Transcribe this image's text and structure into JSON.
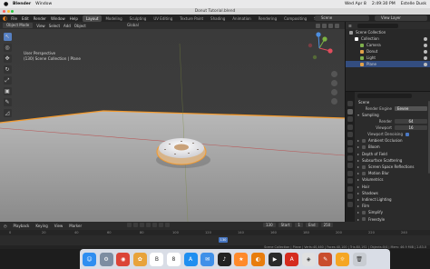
{
  "macos": {
    "apple": "",
    "app": "Blender",
    "menus": [
      "Window"
    ],
    "status_right": [
      "Wed Apr 8",
      "2:49:30 PM",
      "Estelle Dusk"
    ]
  },
  "window": {
    "title": "Donut Tutorial.blend"
  },
  "topbar": {
    "menus": [
      "File",
      "Edit",
      "Render",
      "Window",
      "Help"
    ],
    "tabs": [
      "Layout",
      "Modeling",
      "Sculpting",
      "UV Editing",
      "Texture Paint",
      "Shading",
      "Animation",
      "Rendering",
      "Compositing",
      "Scripting"
    ],
    "active_tab": "Layout",
    "scene": "Scene",
    "view_layer": "View Layer"
  },
  "viewport": {
    "mode": "Object Mode",
    "menus": [
      "View",
      "Select",
      "Add",
      "Object"
    ],
    "orientation": "Global",
    "view_name": "User Perspective",
    "collection_path": "(130) Scene Collection | Plane"
  },
  "outliner": {
    "items": [
      {
        "label": "Scene Collection",
        "indent": 0,
        "selected": false,
        "icon_color": "#9a9a9a"
      },
      {
        "label": "Collection",
        "indent": 1,
        "selected": false,
        "icon_color": "#ffffff"
      },
      {
        "label": "Camera",
        "indent": 2,
        "selected": false,
        "icon_color": "#7fb04d"
      },
      {
        "label": "Donut",
        "indent": 2,
        "selected": false,
        "icon_color": "#e1a24a"
      },
      {
        "label": "Light",
        "indent": 2,
        "selected": false,
        "icon_color": "#7fb04d"
      },
      {
        "label": "Plane",
        "indent": 2,
        "selected": true,
        "icon_color": "#e1a24a"
      }
    ]
  },
  "properties": {
    "scene_label": "Scene",
    "render_engine_label": "Render Engine",
    "render_engine_value": "Eevee",
    "sampling_label": "Sampling",
    "render_label": "Render",
    "render_value": "64",
    "viewport_label": "Viewport",
    "viewport_value": "16",
    "denoise_label": "Viewport Denoising",
    "sections": [
      {
        "label": "Ambient Occlusion",
        "checkbox": true,
        "checked": false
      },
      {
        "label": "Bloom",
        "checkbox": true,
        "checked": false
      },
      {
        "label": "Depth of Field",
        "checkbox": false,
        "checked": false
      },
      {
        "label": "Subsurface Scattering",
        "checkbox": false,
        "checked": false
      },
      {
        "label": "Screen Space Reflections",
        "checkbox": true,
        "checked": false
      },
      {
        "label": "Motion Blur",
        "checkbox": true,
        "checked": false
      },
      {
        "label": "Volumetrics",
        "checkbox": false,
        "checked": false
      },
      {
        "label": "Hair",
        "checkbox": false,
        "checked": false
      },
      {
        "label": "Shadows",
        "checkbox": false,
        "checked": false
      },
      {
        "label": "Indirect Lighting",
        "checkbox": false,
        "checked": false
      },
      {
        "label": "Film",
        "checkbox": false,
        "checked": false
      },
      {
        "label": "Simplify",
        "checkbox": true,
        "checked": false
      },
      {
        "label": "Freestyle",
        "checkbox": true,
        "checked": false
      },
      {
        "label": "Color Management",
        "checkbox": false,
        "checked": false
      }
    ]
  },
  "timeline": {
    "menus": [
      "Playback",
      "Keying",
      "View",
      "Marker"
    ],
    "current_frame": "130",
    "start_label": "Start",
    "start_value": "1",
    "end_label": "End",
    "end_value": "250",
    "ticks": [
      "0",
      "20",
      "40",
      "60",
      "80",
      "100",
      "120",
      "140",
      "160",
      "180",
      "200",
      "220",
      "240"
    ]
  },
  "statusbar": {
    "right": "Scene Collection | Plane | Verts:40,460 | Faces:40,100 | Tris:80,192 | Objects:0/4 | Mem: 46.9 MiB | 2.83.0"
  },
  "dock": {
    "apps": [
      {
        "name": "finder-icon",
        "glyph": "☺",
        "color": "#2f8ef0"
      },
      {
        "name": "system-icon",
        "glyph": "⚙",
        "color": "#7d8da1"
      },
      {
        "name": "chrome-icon",
        "glyph": "◉",
        "color": "#db4437"
      },
      {
        "name": "photos-icon",
        "glyph": "✿",
        "color": "#e8a33b"
      },
      {
        "name": "document-icon",
        "glyph": "B",
        "color": "#ffffff"
      },
      {
        "name": "calendar-icon",
        "glyph": "8",
        "color": "#ffffff"
      },
      {
        "name": "app-store-icon",
        "glyph": "A",
        "color": "#1f8ff0"
      },
      {
        "name": "mail-icon",
        "glyph": "✉",
        "color": "#3f90e8"
      },
      {
        "name": "music-icon",
        "glyph": "♪",
        "color": "#222222"
      },
      {
        "name": "star-icon",
        "glyph": "★",
        "color": "#ff8a2b"
      },
      {
        "name": "blender-icon",
        "glyph": "◐",
        "color": "#e87d0d"
      },
      {
        "name": "terminal-icon",
        "glyph": "▶",
        "color": "#2a2a2a"
      },
      {
        "name": "pdf-icon",
        "glyph": "A",
        "color": "#d52b1e"
      },
      {
        "name": "photo-viewer-icon",
        "glyph": "◈",
        "color": "#e0e0e0"
      },
      {
        "name": "tool-icon",
        "glyph": "✎",
        "color": "#c94d2d"
      },
      {
        "name": "browser-icon",
        "glyph": "☼",
        "color": "#f5a623"
      },
      {
        "name": "trash-icon",
        "glyph": "🗑",
        "color": "#c8ccd2"
      }
    ]
  }
}
